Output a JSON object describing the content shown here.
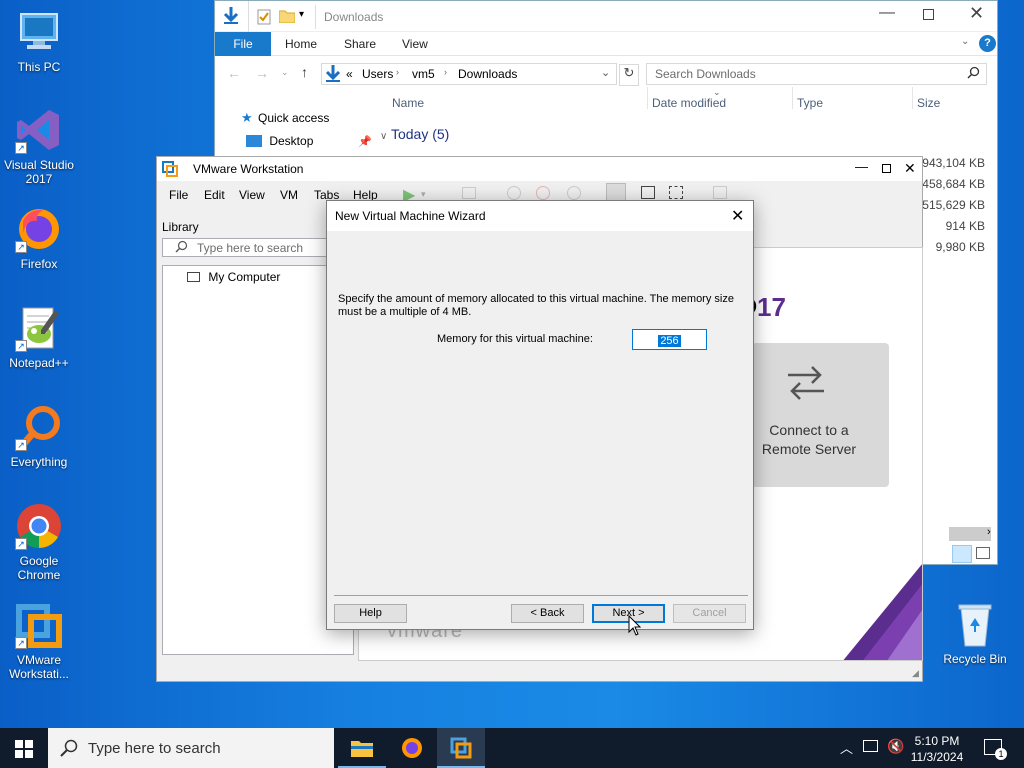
{
  "desktop": {
    "icons": [
      {
        "label": "This PC"
      },
      {
        "label": "Visual Studio 2017"
      },
      {
        "label": "Firefox"
      },
      {
        "label": "Notepad++"
      },
      {
        "label": "Everything"
      },
      {
        "label": "Google Chrome"
      },
      {
        "label": "VMware Workstati..."
      },
      {
        "label": "Recycle Bin"
      }
    ]
  },
  "explorer": {
    "title": "Downloads",
    "ribbon_tabs": [
      "File",
      "Home",
      "Share",
      "View"
    ],
    "breadcrumb": [
      "«",
      "Users",
      "vm5",
      "Downloads"
    ],
    "search_placeholder": "Search Downloads",
    "columns": [
      "Name",
      "Date modified",
      "Type",
      "Size"
    ],
    "nav": {
      "quick_access": "Quick access",
      "desktop": "Desktop"
    },
    "group_header": "Today (5)",
    "sizes": [
      "943,104 KB",
      "458,684 KB",
      "515,629 KB",
      "914 KB",
      "9,980 KB"
    ]
  },
  "vmware": {
    "title": "VMware Workstation",
    "menu": [
      "File",
      "Edit",
      "View",
      "VM",
      "Tabs",
      "Help"
    ],
    "library": {
      "label": "Library",
      "search_placeholder": "Type here to search",
      "tree_root": "My Computer"
    },
    "home": {
      "version": "17",
      "connect_label": "Connect to a Remote Server",
      "watermark": "vmware"
    }
  },
  "dialog": {
    "title": "New Virtual Machine Wizard",
    "description": "Specify the amount of memory allocated to this virtual machine. The memory size must be a multiple of 4 MB.",
    "memory_label": "Memory for this virtual machine:",
    "memory_value": "256",
    "buttons": {
      "help": "Help",
      "back": "< Back",
      "next": "Next >",
      "cancel": "Cancel"
    }
  },
  "taskbar": {
    "search_placeholder": "Type here to search",
    "time": "5:10 PM",
    "date": "11/3/2024",
    "notification_count": "1"
  },
  "colors": {
    "accent": "#0078d7",
    "vmware_purple": "#5b2d8e",
    "taskbar": "#101c2c"
  }
}
